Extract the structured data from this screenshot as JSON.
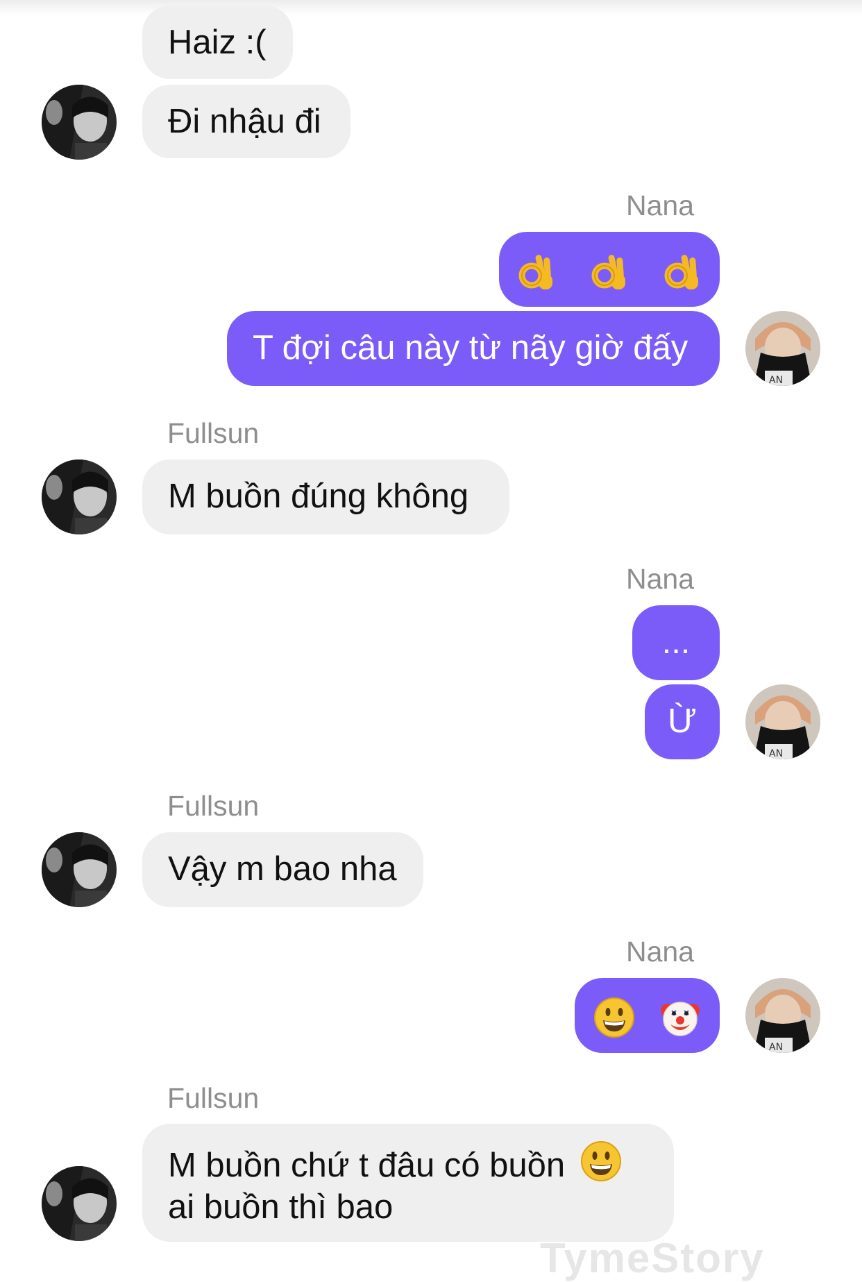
{
  "conversation": {
    "me_name": "Nana",
    "other_name": "Fullsun",
    "messages": {
      "m1": "Haiz :(",
      "m2": "Đi nhậu đi",
      "m3_icon": "ok-hand-emoji x3",
      "m4": "T đợi câu này từ nãy giờ đấy",
      "m5": "M buồn đúng không",
      "m6": "...",
      "m7": "Ừ",
      "m8": "Vậy m bao nha",
      "m9_icons": "grinning-face-emoji, clown-face-emoji",
      "m10_line1": "M buồn chứ t đâu có buồn",
      "m10_line2": "ai buồn thì bao"
    }
  },
  "colors": {
    "outgoing_bubble": "#7b5cf9",
    "incoming_bubble": "#efefef",
    "sender_label": "#8e8e8e"
  },
  "watermark": "TymeStory"
}
